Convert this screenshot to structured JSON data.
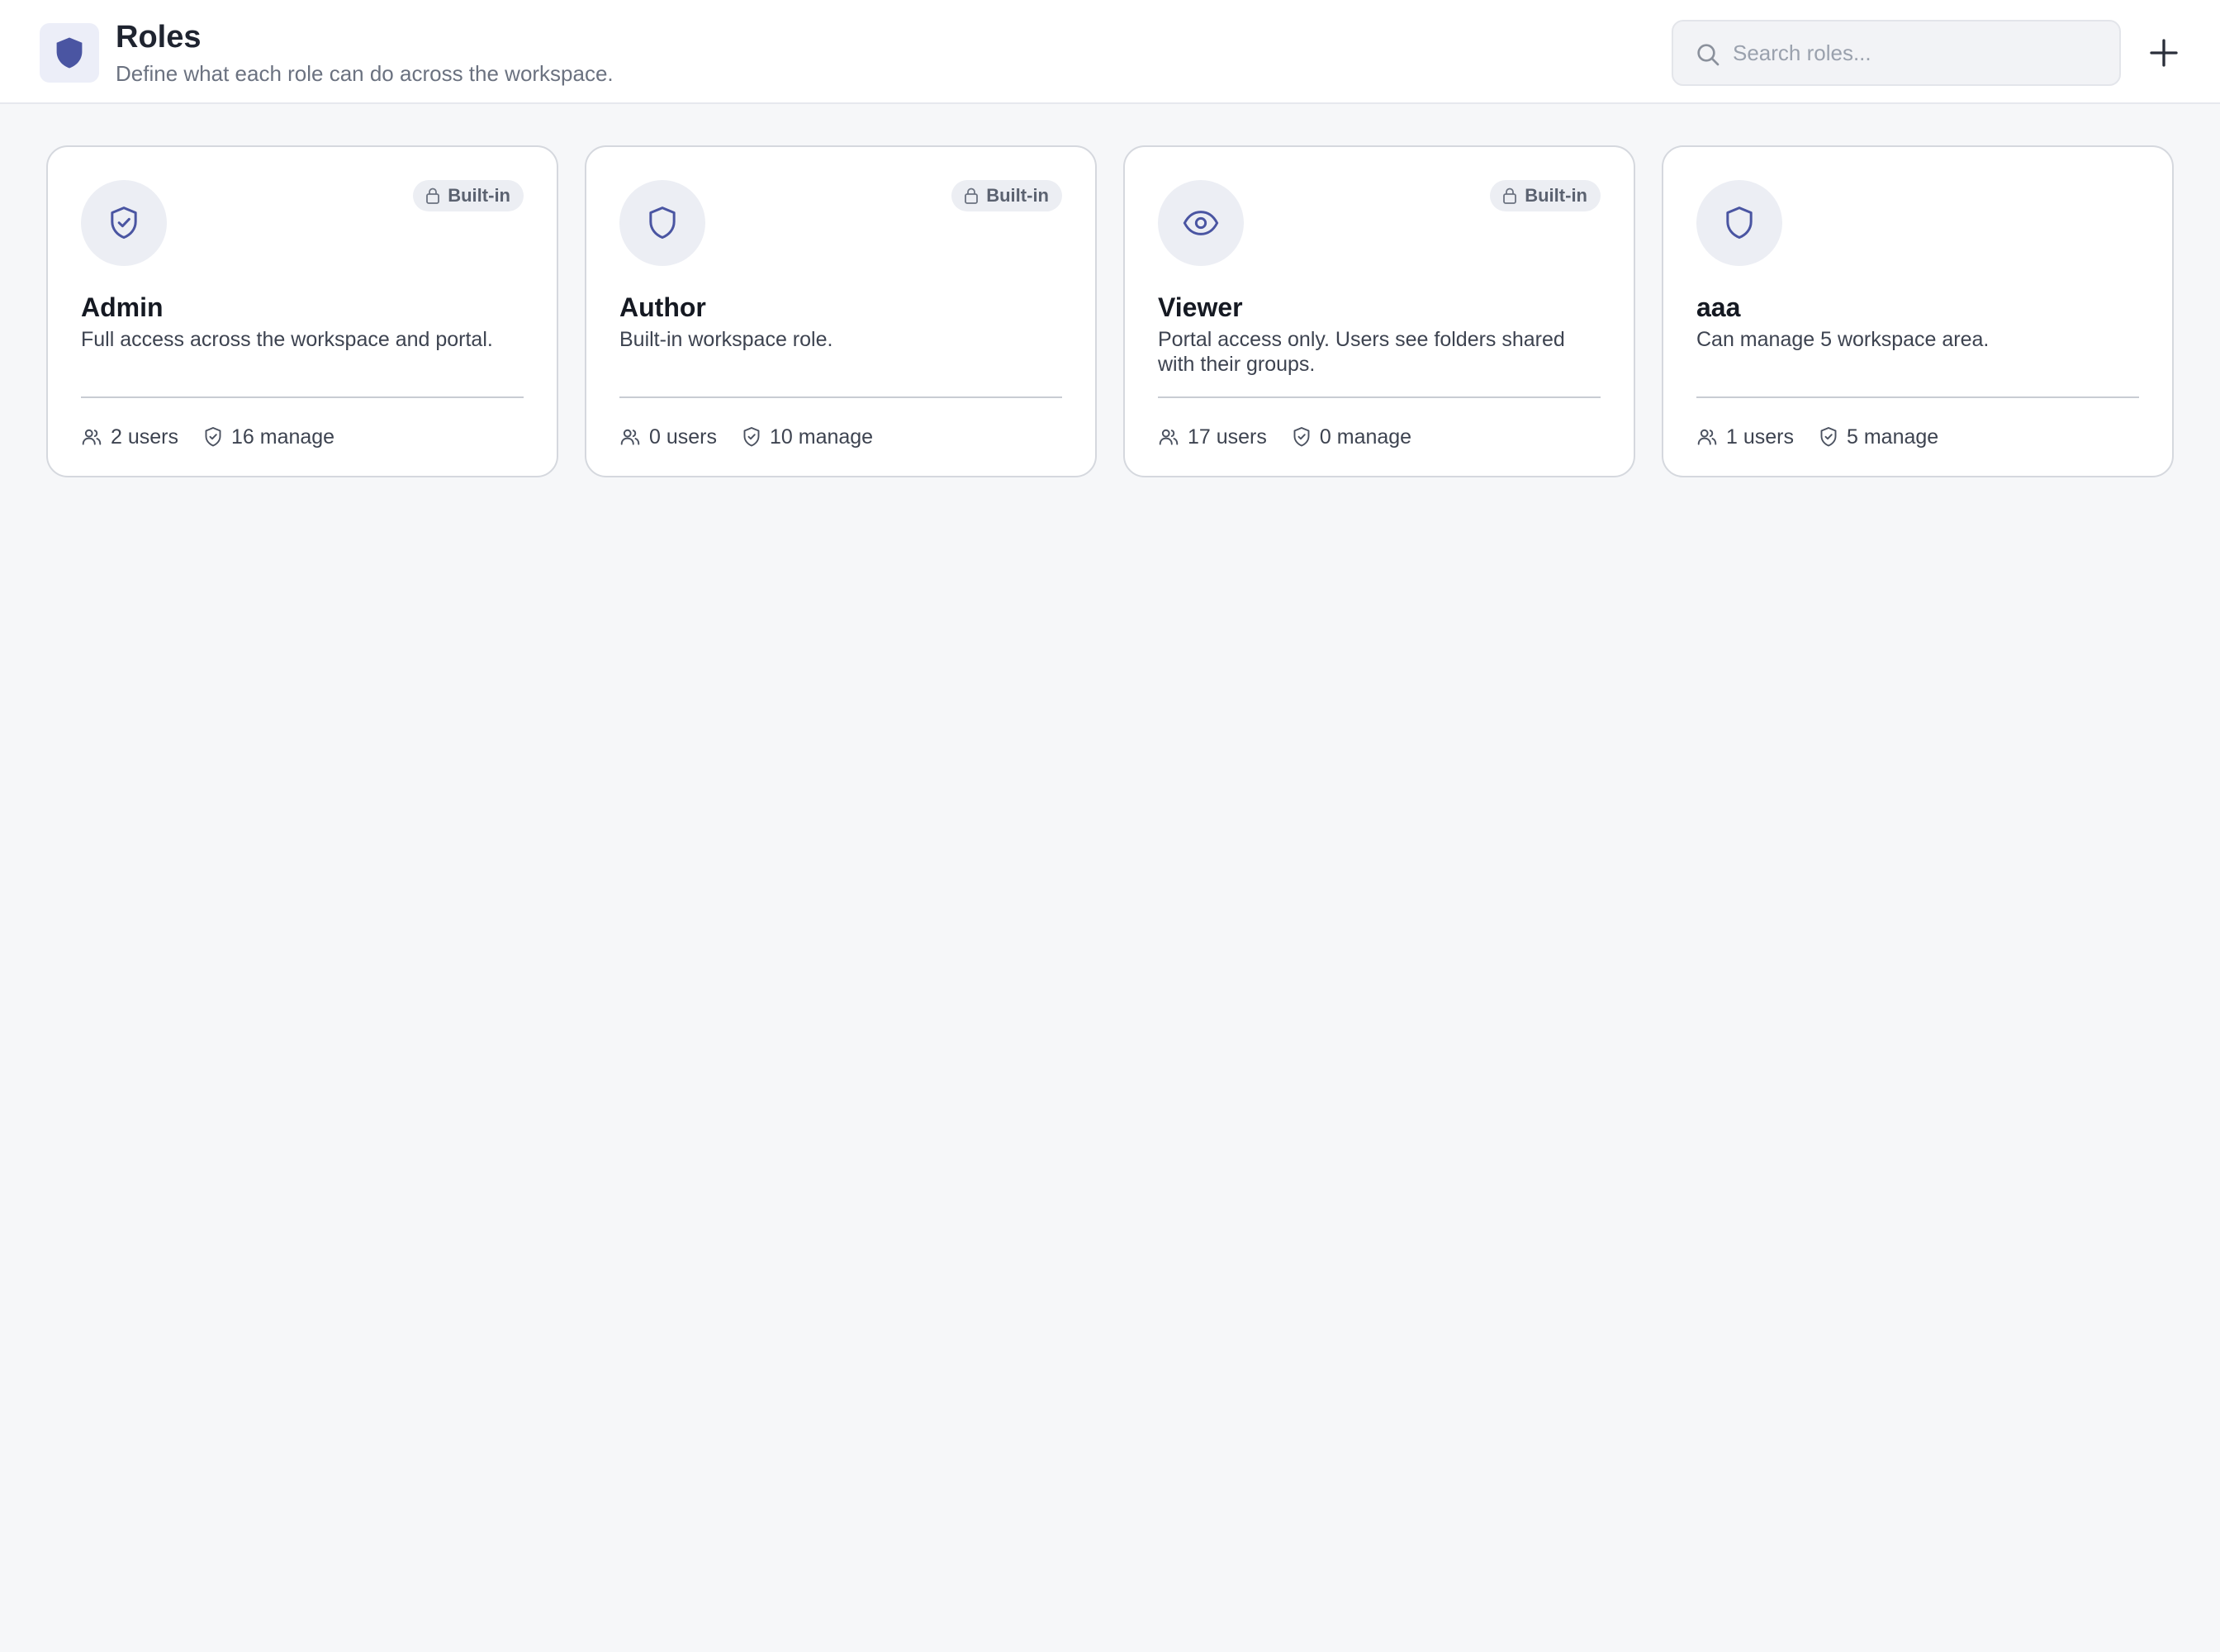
{
  "header": {
    "title": "Roles",
    "subtitle": "Define what each role can do across the workspace.",
    "app_icon": "shield-icon",
    "search": {
      "placeholder": "Search roles...",
      "value": ""
    },
    "add_icon": "plus-icon"
  },
  "colors": {
    "accent": "#4a55a2",
    "background": "#f6f7f9",
    "card": "#ffffff",
    "badge_bg": "#eceef3"
  },
  "roles": [
    {
      "name": "Admin",
      "description": "Full access across the workspace and portal.",
      "badge": "Built-in",
      "icon": "shield-check-icon",
      "users": "2 users",
      "manage": "16 manage"
    },
    {
      "name": "Author",
      "description": "Built-in workspace role.",
      "badge": "Built-in",
      "icon": "shield-icon",
      "users": "0 users",
      "manage": "10 manage"
    },
    {
      "name": "Viewer",
      "description": "Portal access only. Users see folders shared with their groups.",
      "badge": "Built-in",
      "icon": "eye-icon",
      "users": "17 users",
      "manage": "0 manage"
    },
    {
      "name": "aaa",
      "description": "Can manage 5 workspace area.",
      "badge": "",
      "icon": "shield-icon",
      "users": "1 users",
      "manage": "5 manage"
    }
  ]
}
